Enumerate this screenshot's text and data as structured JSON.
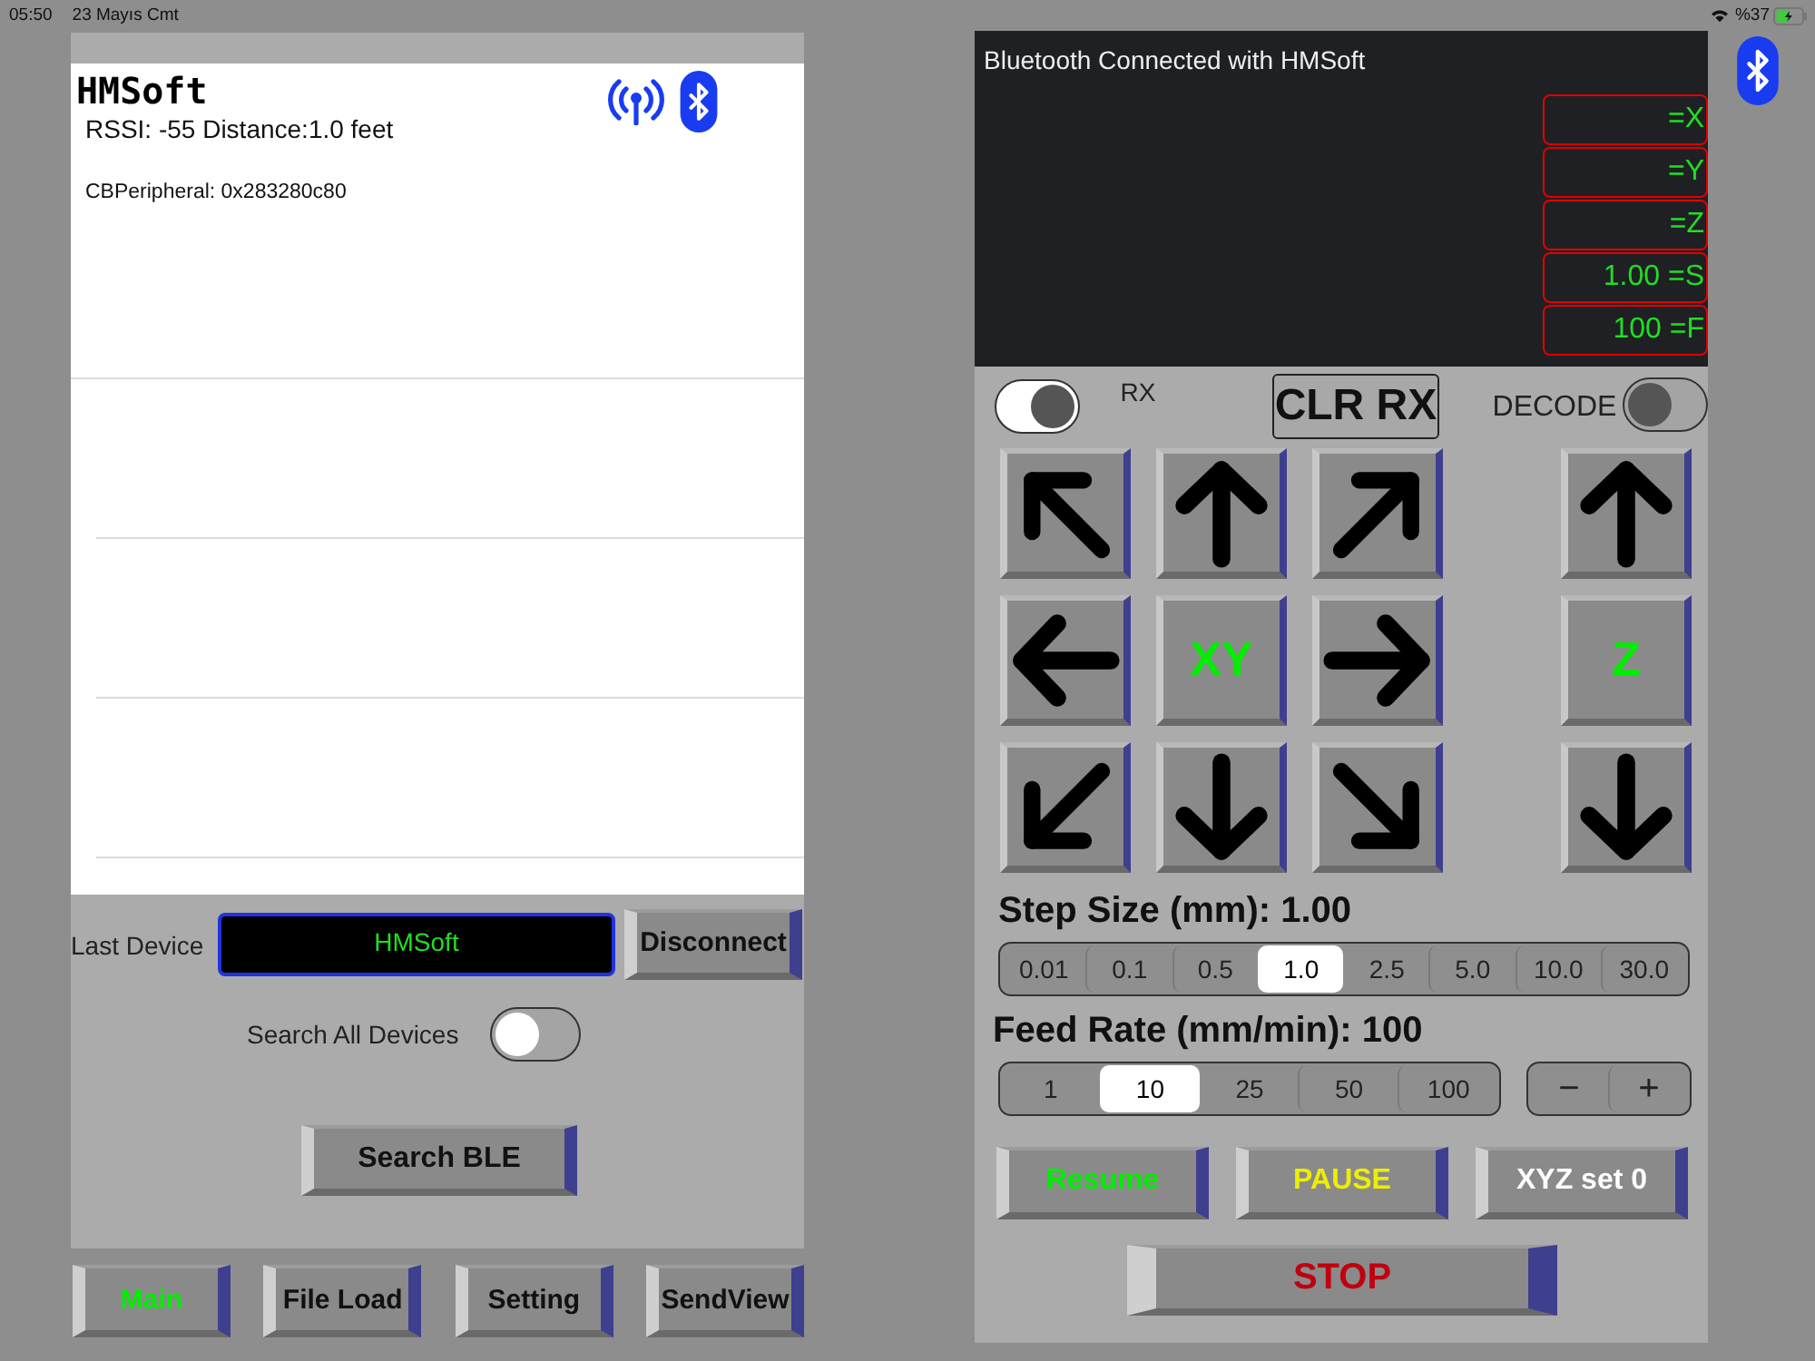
{
  "status_bar": {
    "time": "05:50",
    "date": "23 Mayıs Cmt",
    "battery": "%37"
  },
  "device_list": {
    "devices": [
      {
        "name": "HMSoft",
        "signal": "RSSI: -55 Distance:1.0 feet",
        "peripheral": "CBPeripheral: 0x283280c80"
      }
    ]
  },
  "last_device": {
    "label": "Last Device",
    "value": "HMSoft"
  },
  "disconnect_button": "Disconnect",
  "search_all": {
    "label": "Search All Devices",
    "on": false
  },
  "search_button": "Search BLE",
  "tabs": [
    {
      "label": "Main",
      "selected": true
    },
    {
      "label": "File Load",
      "selected": false
    },
    {
      "label": "Setting",
      "selected": false
    },
    {
      "label": "SendView",
      "selected": false
    }
  ],
  "console": {
    "message": "Bluetooth Connected with HMSoft",
    "readouts": [
      "=X",
      "=Y",
      "=Z",
      "1.00 =S",
      "100 =F"
    ]
  },
  "rx": {
    "label": "RX",
    "on": true
  },
  "clear_button": "CLR RX",
  "decode": {
    "label": "DECODE",
    "on": false
  },
  "jog": {
    "xy_label": "XY",
    "z_label": "Z"
  },
  "step_size": {
    "label": "Step Size (mm): 1.00",
    "options": [
      {
        "label": "0.01",
        "selected": false
      },
      {
        "label": "0.1",
        "selected": false
      },
      {
        "label": "0.5",
        "selected": false
      },
      {
        "label": "1.0",
        "selected": true
      },
      {
        "label": "2.5",
        "selected": false
      },
      {
        "label": "5.0",
        "selected": false
      },
      {
        "label": "10.0",
        "selected": false
      },
      {
        "label": "30.0",
        "selected": false
      }
    ]
  },
  "feed_rate": {
    "label": "Feed Rate (mm/min): 100",
    "options": [
      {
        "label": "1",
        "selected": false
      },
      {
        "label": "10",
        "selected": true
      },
      {
        "label": "25",
        "selected": false
      },
      {
        "label": "50",
        "selected": false
      },
      {
        "label": "100",
        "selected": false
      }
    ],
    "stepper": [
      "−",
      "+"
    ]
  },
  "actions": [
    {
      "label": "Resume",
      "color": "#00ee00"
    },
    {
      "label": "PAUSE",
      "color": "#eeee00"
    },
    {
      "label": "XYZ set 0",
      "color": "#ffffff"
    }
  ],
  "stop_button": {
    "label": "STOP",
    "color": "#c00010"
  }
}
